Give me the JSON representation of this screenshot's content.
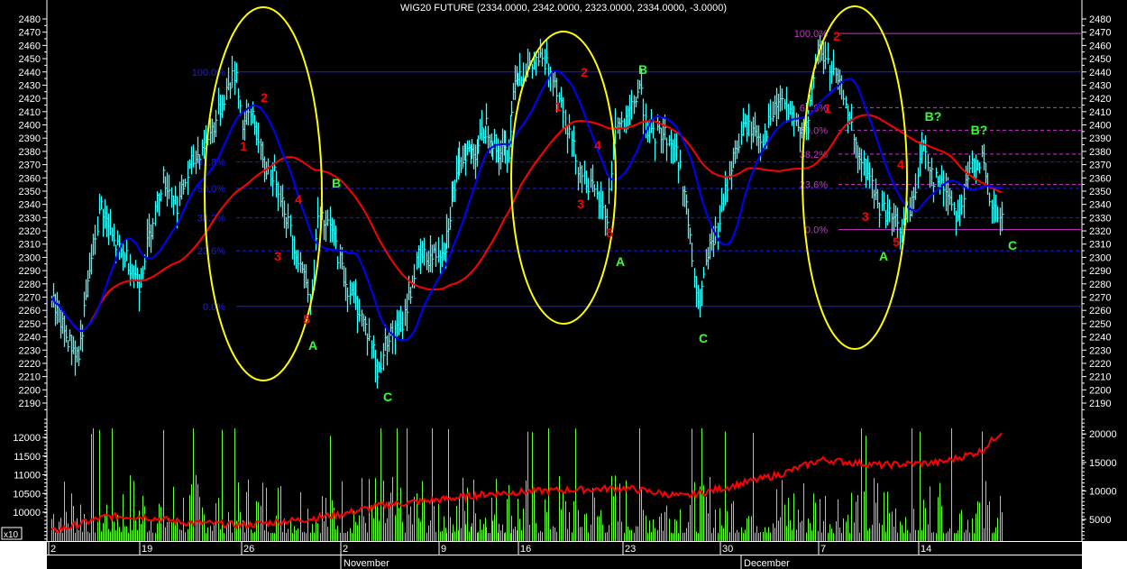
{
  "title": "WIG20 FUTURE (2334.0000, 2342.0000, 2323.0000, 2334.0000, -3.0000)",
  "colors": {
    "bars": "#33ffff",
    "fast_ma": "#0000ff",
    "slow_ma": "#ff0000",
    "volume": "#66ff33",
    "ellipse": "#ffff00",
    "fib1": "#1a1aff",
    "fib2": "#cc33cc",
    "wave_red": "#ff0000",
    "wave_green": "#33ff33"
  },
  "volume_multiplier_label": "x10",
  "chart_data": {
    "type": "line",
    "title": "WIG20 FUTURE (2334.0000, 2342.0000, 2323.0000, 2334.0000, -3.0000)",
    "price_axis": {
      "ylim": [
        2185,
        2485
      ],
      "ticks": [
        2190,
        2200,
        2210,
        2220,
        2230,
        2240,
        2250,
        2260,
        2270,
        2280,
        2290,
        2300,
        2310,
        2320,
        2330,
        2340,
        2350,
        2360,
        2370,
        2380,
        2390,
        2400,
        2410,
        2420,
        2430,
        2440,
        2450,
        2460,
        2470,
        2480
      ]
    },
    "volume_axis_left": {
      "ticks": [
        "12000",
        "11500",
        "11000",
        "10500",
        "10000"
      ]
    },
    "volume_axis_right": {
      "ticks": [
        "20000",
        "15000",
        "10000",
        "5000"
      ]
    },
    "x_ticks": [
      "2",
      "19",
      "26",
      "2",
      "9",
      "16",
      "23",
      "30",
      "7",
      "14"
    ],
    "months": [
      "November",
      "December"
    ],
    "price_path_xunit": "trading-day index",
    "price_path": [
      [
        0,
        2270
      ],
      [
        0.8,
        2240
      ],
      [
        1.5,
        2225
      ],
      [
        2.2,
        2300
      ],
      [
        2.7,
        2340
      ],
      [
        3.4,
        2310
      ],
      [
        4.1,
        2300
      ],
      [
        4.8,
        2280
      ],
      [
        5.5,
        2330
      ],
      [
        6.0,
        2360
      ],
      [
        6.7,
        2340
      ],
      [
        7.4,
        2370
      ],
      [
        7.8,
        2380
      ],
      [
        8.5,
        2400
      ],
      [
        9.2,
        2430
      ],
      [
        9.6,
        2440
      ],
      [
        9.9,
        2400
      ],
      [
        10.4,
        2410
      ],
      [
        10.9,
        2370
      ],
      [
        11.6,
        2360
      ],
      [
        12.3,
        2320
      ],
      [
        12.7,
        2300
      ],
      [
        13.4,
        2270
      ],
      [
        13.7,
        2330
      ],
      [
        14.4,
        2320
      ],
      [
        15.1,
        2280
      ],
      [
        15.8,
        2260
      ],
      [
        16.5,
        2230
      ],
      [
        16.7,
        2210
      ],
      [
        17.2,
        2240
      ],
      [
        17.9,
        2245
      ],
      [
        18.8,
        2300
      ],
      [
        19.5,
        2300
      ],
      [
        20.2,
        2310
      ],
      [
        20.7,
        2350
      ],
      [
        21.4,
        2380
      ],
      [
        22.1,
        2380
      ],
      [
        22.8,
        2400
      ],
      [
        23.5,
        2380
      ],
      [
        24.2,
        2380
      ],
      [
        24.6,
        2440
      ],
      [
        25.3,
        2440
      ],
      [
        25.8,
        2450
      ],
      [
        26.5,
        2440
      ],
      [
        27.2,
        2400
      ],
      [
        27.7,
        2370
      ],
      [
        28.4,
        2350
      ],
      [
        29.1,
        2330
      ],
      [
        29.5,
        2400
      ],
      [
        30.0,
        2400
      ],
      [
        30.7,
        2430
      ],
      [
        31.2,
        2390
      ],
      [
        31.9,
        2395
      ],
      [
        32.6,
        2380
      ],
      [
        33.0,
        2350
      ],
      [
        33.7,
        2260
      ],
      [
        34.2,
        2300
      ],
      [
        34.7,
        2320
      ],
      [
        35.4,
        2370
      ],
      [
        36.1,
        2400
      ],
      [
        37.0,
        2390
      ],
      [
        37.9,
        2420
      ],
      [
        38.6,
        2400
      ],
      [
        39.3,
        2400
      ],
      [
        39.8,
        2460
      ],
      [
        40.5,
        2440
      ],
      [
        41.2,
        2420
      ],
      [
        41.7,
        2380
      ],
      [
        42.4,
        2360
      ],
      [
        42.8,
        2340
      ],
      [
        43.5,
        2330
      ],
      [
        44.0,
        2320
      ],
      [
        44.5,
        2340
      ],
      [
        45.1,
        2385
      ],
      [
        45.6,
        2360
      ],
      [
        46.3,
        2350
      ],
      [
        46.8,
        2330
      ],
      [
        47.5,
        2370
      ],
      [
        48.0,
        2375
      ],
      [
        48.4,
        2340
      ],
      [
        49.1,
        2325
      ]
    ],
    "volume_ma_path": [
      [
        0,
        2800
      ],
      [
        3,
        5500
      ],
      [
        5,
        5500
      ],
      [
        7,
        4500
      ],
      [
        10,
        4000
      ],
      [
        13,
        5000
      ],
      [
        15,
        6000
      ],
      [
        17,
        7500
      ],
      [
        20,
        8500
      ],
      [
        23,
        9500
      ],
      [
        26,
        10000
      ],
      [
        30,
        10500
      ],
      [
        33,
        9000
      ],
      [
        35,
        10500
      ],
      [
        38,
        13000
      ],
      [
        40,
        15500
      ],
      [
        43,
        14500
      ],
      [
        46,
        15000
      ],
      [
        48,
        17000
      ],
      [
        49,
        20500
      ]
    ],
    "fibonacci_sets": [
      {
        "name": "first",
        "color": "#1a1aff",
        "levels": [
          {
            "label": "100.0%",
            "price": 2440
          },
          {
            "label": "61.8%",
            "price": 2372
          },
          {
            "label": "50.0%",
            "price": 2352
          },
          {
            "label": "38.2%",
            "price": 2330
          },
          {
            "label": "23.6%",
            "price": 2305
          },
          {
            "label": "0.0%",
            "price": 2263
          }
        ]
      },
      {
        "name": "third",
        "color": "#cc33cc",
        "levels": [
          {
            "label": "100.0%",
            "price": 2469
          },
          {
            "label": "61.8%",
            "price": 2413
          },
          {
            "label": "50.0%",
            "price": 2396
          },
          {
            "label": "38.2%",
            "price": 2378
          },
          {
            "label": "23.6%",
            "price": 2355
          },
          {
            "label": "0.0%",
            "price": 2321
          }
        ]
      }
    ],
    "wave_labels": [
      {
        "text": "1",
        "color": "red"
      },
      {
        "text": "2",
        "color": "red"
      },
      {
        "text": "3",
        "color": "red"
      },
      {
        "text": "4",
        "color": "red"
      },
      {
        "text": "5",
        "color": "red"
      },
      {
        "text": "A",
        "color": "green"
      },
      {
        "text": "B",
        "color": "green"
      },
      {
        "text": "C",
        "color": "green"
      },
      {
        "text": "1",
        "color": "red"
      },
      {
        "text": "2",
        "color": "red"
      },
      {
        "text": "3",
        "color": "red"
      },
      {
        "text": "4",
        "color": "red"
      },
      {
        "text": "5",
        "color": "red"
      },
      {
        "text": "A",
        "color": "green"
      },
      {
        "text": "B",
        "color": "green"
      },
      {
        "text": "C",
        "color": "green"
      },
      {
        "text": "1",
        "color": "red"
      },
      {
        "text": "2",
        "color": "red"
      },
      {
        "text": "3",
        "color": "red"
      },
      {
        "text": "4",
        "color": "red"
      },
      {
        "text": "5",
        "color": "red"
      },
      {
        "text": "A",
        "color": "green"
      },
      {
        "text": "B?",
        "color": "green"
      },
      {
        "text": "B?",
        "color": "green"
      },
      {
        "text": "C",
        "color": "green"
      }
    ]
  }
}
